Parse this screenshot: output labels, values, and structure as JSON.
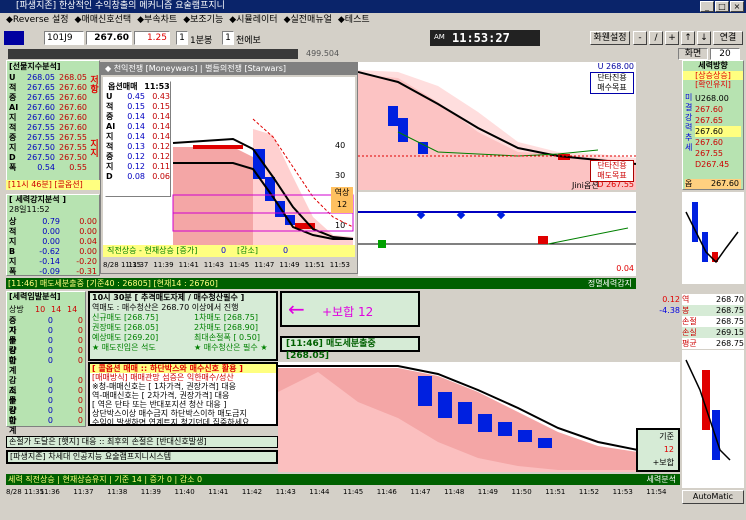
{
  "window": {
    "title": "[파생지존] 한상적인 수익창출의 메커니즘 요술램프지니"
  },
  "menu": [
    "◆Reverse 설정",
    "◆매매신호선택",
    "◆부속차트",
    "◆보조기능",
    "◆시뮬레이터",
    "◆실전매뉴얼",
    "◆테스트"
  ],
  "toolbar": {
    "code": "101J9",
    "price": "267.60",
    "change": "1.25",
    "qty": "1",
    "qty_label": "1분봉",
    "qty2": "1",
    "qty2_label": "천에보",
    "clock_tag": "AM",
    "time": "11:53:27",
    "btn_layout": "화웬설정",
    "zoom_label": "화면",
    "zoom_value": "20",
    "sub_value": "499.504"
  },
  "left_panel": {
    "title": "[선물지수분석]",
    "rows": [
      {
        "k": "U",
        "a": "268.05",
        "b": "268.05"
      },
      {
        "k": "적",
        "a": "267.65",
        "b": "267.60"
      },
      {
        "k": "중",
        "a": "267.65",
        "b": "267.60"
      },
      {
        "k": "AI",
        "a": "267.60",
        "b": "267.60"
      },
      {
        "k": "지",
        "a": "267.60",
        "b": "267.60"
      },
      {
        "k": "적",
        "a": "267.55",
        "b": "267.60"
      },
      {
        "k": "중",
        "a": "267.55",
        "b": "267.55"
      },
      {
        "k": "지",
        "a": "267.50",
        "b": "267.55"
      },
      {
        "k": "D",
        "a": "267.50",
        "b": "267.50"
      },
      {
        "k": "폭",
        "a": "0.54",
        "b": "0.55"
      }
    ],
    "side_top": "저항",
    "side_bot": "지지",
    "footer": "[11시 46분] [콜옵션]",
    "title2": "[ 세력강지분석 ]",
    "time2": "28일11:52",
    "rows2": [
      {
        "k": "상",
        "a": "0.79",
        "b": "0.00"
      },
      {
        "k": "적",
        "a": "0.00",
        "b": "0.00"
      },
      {
        "k": "지",
        "a": "0.00",
        "b": "0.04"
      },
      {
        "k": "B",
        "a": "-0.62",
        "b": "0.00"
      },
      {
        "k": "지",
        "a": "-0.14",
        "b": "-0.20"
      },
      {
        "k": "폭",
        "a": "-0.09",
        "b": "-0.31"
      }
    ],
    "title3": "[세력임발분석]",
    "sum_hdr": [
      "상방",
      "10",
      "14",
      "14"
    ],
    "rows3": [
      {
        "k": "증가",
        "a": "0",
        "b": "0"
      },
      {
        "k": "지수",
        "a": "0",
        "b": "0"
      },
      {
        "k": "물량",
        "a": "0",
        "b": "0"
      },
      {
        "k": "감마",
        "a": "0",
        "b": "0"
      },
      {
        "k": "합계",
        "a": "0",
        "b": "0"
      }
    ],
    "rows4": [
      {
        "k": "감소",
        "a": "0",
        "b": "0"
      },
      {
        "k": "지수",
        "a": "0",
        "b": "0"
      },
      {
        "k": "물량",
        "a": "0",
        "b": "0"
      },
      {
        "k": "감마",
        "a": "0",
        "b": "0"
      },
      {
        "k": "합계",
        "a": "0",
        "b": "0"
      }
    ]
  },
  "popup": {
    "title": "◆ 천익전쟁 [Moneywars] | 별들의전쟁 [Starwars]",
    "mini_title": "옵션매매",
    "mini_time": "11:53",
    "mini_rows": [
      {
        "k": "U",
        "a": "0.45",
        "b": "0.43"
      },
      {
        "k": "적",
        "a": "0.15",
        "b": "0.15"
      },
      {
        "k": "중",
        "a": "0.14",
        "b": "0.14"
      },
      {
        "k": "AI",
        "a": "0.14",
        "b": "0.14"
      },
      {
        "k": "지",
        "a": "0.14",
        "b": "0.14"
      },
      {
        "k": "적",
        "a": "0.13",
        "b": "0.12"
      },
      {
        "k": "중",
        "a": "0.12",
        "b": "0.12"
      },
      {
        "k": "지",
        "a": "0.12",
        "b": "0.11"
      },
      {
        "k": "D",
        "a": "0.08",
        "b": "0.06"
      }
    ],
    "price_labels": [
      "40",
      "30",
      "10"
    ],
    "tag": "역상",
    "tag_value": "12",
    "bottom_text": "직전상승 - 현재상승 [증가]",
    "bottom_v1": "0",
    "bottom_mid": "[감소]",
    "bottom_v2": "0",
    "times": [
      "8/28 11:35",
      "11:37",
      "11:39",
      "11:41",
      "11:43",
      "11:45",
      "11:47",
      "11:49",
      "11:51",
      "11:53"
    ]
  },
  "right_chart": {
    "u_label": "U 268.00",
    "tag1": "단타진용",
    "tag2": "매수목표",
    "tag3": "단타진용",
    "tag4": "매도목표",
    "jini": "Jini옵션",
    "d_label": "D 267.55",
    "val_084": "0.04"
  },
  "status_strip": {
    "text": "[11:46] 매도세분출중 [기준40 : 26805] [현재14 : 26760]",
    "right": "정멸세력감지"
  },
  "right_panel": {
    "title": "세력방향",
    "tag": "[상승상승]",
    "tag2": "[확인유지]",
    "vert": "미결강력추세",
    "rows": [
      {
        "k": "U",
        "v": "268.00"
      },
      {
        "k": "",
        "v": "267.60"
      },
      {
        "k": "",
        "v": "267.65"
      },
      {
        "k": "",
        "v": "267.60"
      },
      {
        "k": "",
        "v": "267.60"
      },
      {
        "k": "",
        "v": "267.55"
      },
      {
        "k": "D",
        "v": "267.45"
      }
    ],
    "box_label": "옵",
    "box_value": "267.60",
    "bottom_rows": [
      {
        "k": "역",
        "v": "268.70"
      },
      {
        "k": "봉",
        "v": "268.75"
      },
      {
        "k": "손절",
        "v": "268.75"
      },
      {
        "k": "손실",
        "v": "269.15"
      },
      {
        "k": "평균",
        "v": "268.75"
      }
    ],
    "val1": "0.12",
    "val2": "-4.38",
    "auto": "AutoMatic"
  },
  "info_panel": {
    "title": "10시 30분 [ 추격매도자제 / 매수청산필수 ]",
    "lines": [
      "역매도 : 매수청산은 268.70 이상에서 진행",
      "신규매도 [268.75]",
      "권장매도 [268.05]",
      "예상매도 [269.20]",
      "1차매도 [268.75]",
      "2차매도 [268.90]",
      "최대손절폭 [ 0.50]",
      "★ 매도진입은 석도",
      "★ 매수청산은 필수 ★"
    ],
    "arrow_text": "+보합 12",
    "signal": "[11:46] 매도세분출중[268.05]",
    "bottom_title": "[ 콜옵션 매매 :: 하단박스와 매수신호 활용 ]",
    "bottom_lines": [
      "[매매방식] 매매관망 섬증은 익한매수/성산",
      "※청-매매신호는 [ 1차가격, 권장가격] 대응",
      "역-매매신호는 [ 2차가격, 권장가격] 대응",
      "[ 역은 단타 또는 반대포지션 청산 대응 ]",
      "상단박스이상 매수금지  하단박스이하 매도금지",
      "수익이 발생하면 연계트지 청기던데 집중하세요"
    ],
    "loss_line": "손절가 도달은 [햇지] 대응 :: 최후의 손절은 [반대신호발생]",
    "brand": "[파생지존] 차세대 인공지능 요술램프지니시스템",
    "box_right": [
      "기준",
      "12",
      "+보합"
    ],
    "bottom_status": "세력 직전상승 | 현재상승유지 | 기준 14 | 증가 0 | 감소 0",
    "bottom_status_right": "세력분석",
    "times": [
      "8/28 11:35",
      "11:36",
      "11:37",
      "11:38",
      "11:39",
      "11:40",
      "11:41",
      "11:42",
      "11:43",
      "11:44",
      "11:45",
      "11:46",
      "11:47",
      "11:48",
      "11:49",
      "11:50",
      "11:51",
      "11:52",
      "11:53",
      "11:54"
    ]
  }
}
